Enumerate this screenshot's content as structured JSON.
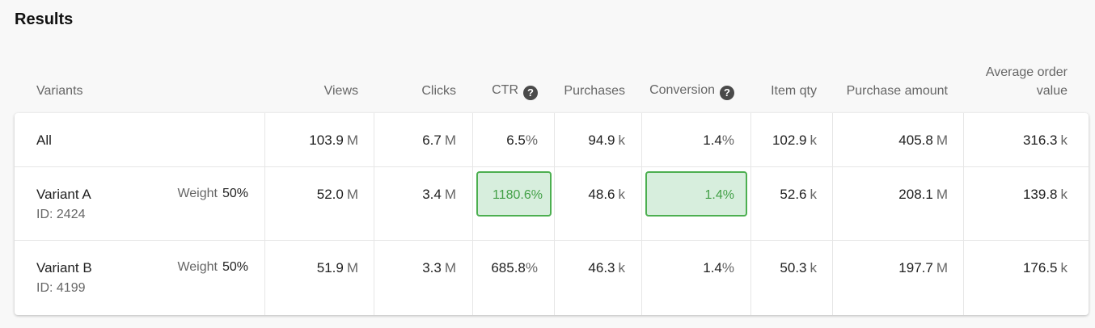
{
  "title": "Results",
  "columns": {
    "variants": "Variants",
    "views": "Views",
    "clicks": "Clicks",
    "ctr": "CTR",
    "purchases": "Purchases",
    "conversion": "Conversion",
    "item_qty": "Item qty",
    "purchase_amount": "Purchase amount",
    "aov_line1": "Average order",
    "aov_line2": "value"
  },
  "rows": [
    {
      "name": "All",
      "views": {
        "v": "103.9",
        "u": "M"
      },
      "clicks": {
        "v": "6.7",
        "u": "M"
      },
      "ctr": {
        "v": "6.5",
        "u": "%"
      },
      "purchases": {
        "v": "94.9",
        "u": "k"
      },
      "conversion": {
        "v": "1.4",
        "u": "%"
      },
      "item_qty": {
        "v": "102.9",
        "u": "k"
      },
      "purchase_amount": {
        "v": "405.8",
        "u": "M"
      },
      "aov": {
        "v": "316.3",
        "u": "k"
      }
    },
    {
      "name": "Variant A",
      "id": "ID: 2424",
      "weight_label": "Weight",
      "weight": "50%",
      "views": {
        "v": "52.0",
        "u": "M"
      },
      "clicks": {
        "v": "3.4",
        "u": "M"
      },
      "ctr": {
        "v": "1180.6%"
      },
      "purchases": {
        "v": "48.6",
        "u": "k"
      },
      "conversion": {
        "v": "1.4%"
      },
      "item_qty": {
        "v": "52.6",
        "u": "k"
      },
      "purchase_amount": {
        "v": "208.1",
        "u": "M"
      },
      "aov": {
        "v": "139.8",
        "u": "k"
      }
    },
    {
      "name": "Variant B",
      "id": "ID: 4199",
      "weight_label": "Weight",
      "weight": "50%",
      "views": {
        "v": "51.9",
        "u": "M"
      },
      "clicks": {
        "v": "3.3",
        "u": "M"
      },
      "ctr": {
        "v": "685.8",
        "u": "%"
      },
      "purchases": {
        "v": "46.3",
        "u": "k"
      },
      "conversion": {
        "v": "1.4",
        "u": "%"
      },
      "item_qty": {
        "v": "50.3",
        "u": "k"
      },
      "purchase_amount": {
        "v": "197.7",
        "u": "M"
      },
      "aov": {
        "v": "176.5",
        "u": "k"
      }
    }
  ],
  "icons": {
    "help": "question-circle-icon"
  },
  "colors": {
    "highlight_border": "#4caf50",
    "highlight_bg": "#d7eedd",
    "highlight_text": "#43a047"
  }
}
